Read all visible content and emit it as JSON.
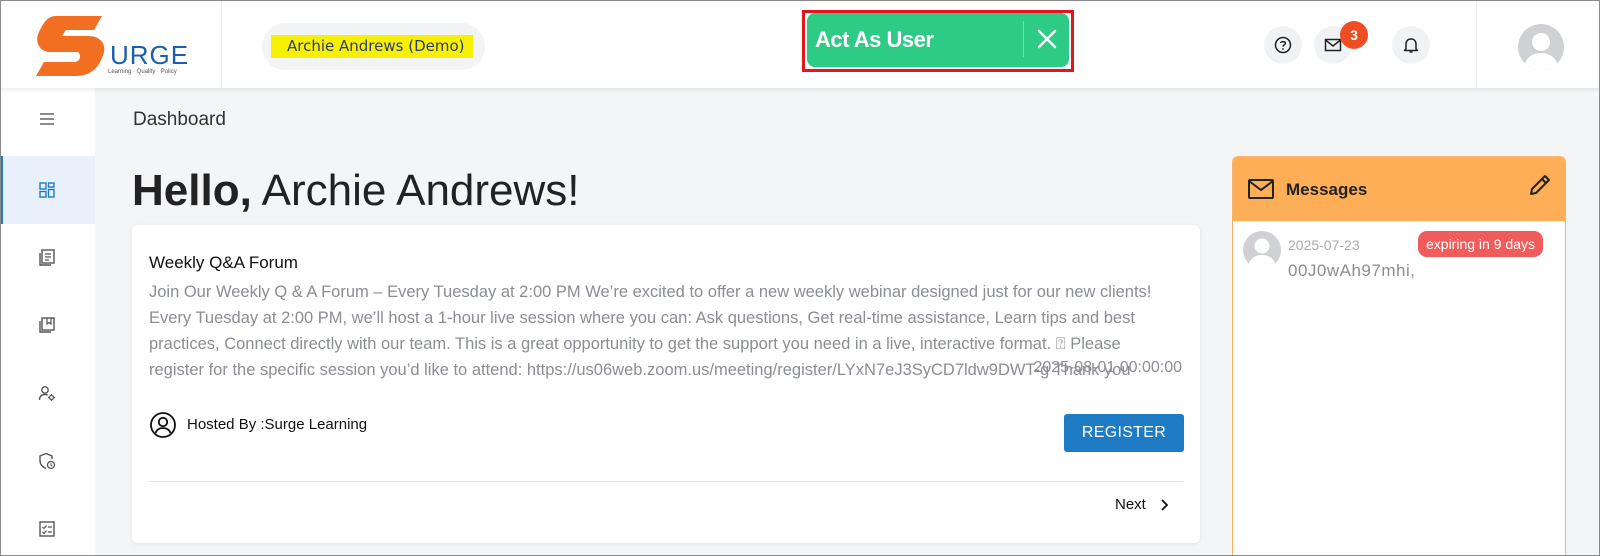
{
  "brand": {
    "name": "URGE",
    "tagline": "Learning · Quality · Policy",
    "accent_orange": "#f26f21",
    "accent_blue": "#1b5fae"
  },
  "header": {
    "current_user_label": "Archie Andrews (Demo)",
    "act_as_user_label": "Act As User",
    "act_as_user_color": "#2ecb86",
    "mail_badge_count": "3",
    "icons": [
      "help-icon",
      "mail-icon",
      "bell-icon",
      "user-avatar-icon"
    ]
  },
  "sidebar": {
    "items": [
      {
        "icon": "menu-icon",
        "active": false
      },
      {
        "icon": "dashboard-icon",
        "active": true
      },
      {
        "icon": "courses-icon",
        "active": false
      },
      {
        "icon": "library-icon",
        "active": false
      },
      {
        "icon": "user-settings-icon",
        "active": false
      },
      {
        "icon": "policy-shield-icon",
        "active": false
      },
      {
        "icon": "tasks-icon",
        "active": false
      }
    ]
  },
  "main": {
    "breadcrumb": "Dashboard",
    "greeting_bold": "Hello,",
    "greeting_name": " Archie Andrews!",
    "event": {
      "title": "Weekly Q&A Forum",
      "description": "Join Our Weekly Q & A Forum – Every Tuesday at 2:00 PM We’re excited to offer a new weekly webinar designed just for our new clients! Every Tuesday at 2:00 PM, we’ll host a 1-hour live session where you can: Ask questions, Get real-time assistance, Learn tips and best practices, Connect directly with our team. This is a great opportunity to get the support you need in a live, interactive format. ⍰ Please register for the specific session you’d like to attend: https://us06web.zoom.us/meeting/register/LYxN7eJ3SyCD7ldw9DWT-g Thank you",
      "datetime": "2025-08-01 00:00:00",
      "host_label": "Hosted By :Surge Learning",
      "register_label": "REGISTER",
      "next_label": "Next"
    }
  },
  "messages": {
    "title": "Messages",
    "items": [
      {
        "date": "2025-07-23",
        "badge": "expiring in 9 days",
        "text": "00J0wAh97mhi,"
      }
    ]
  }
}
